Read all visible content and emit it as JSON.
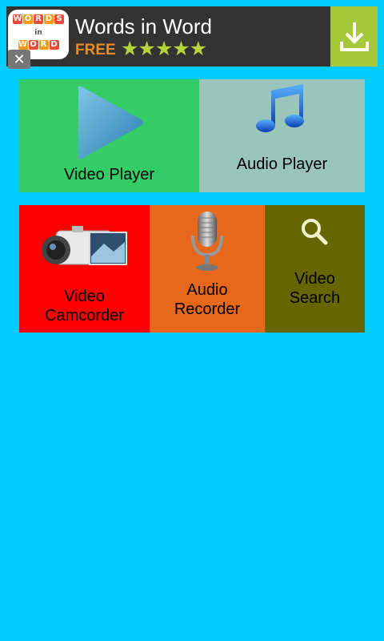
{
  "ad": {
    "title": "Words in Word",
    "price": "FREE",
    "stars": "★★★★★",
    "logo_rows": [
      [
        "W",
        "O",
        "R",
        "D",
        "S"
      ],
      [
        "in"
      ],
      [
        "W",
        "O",
        "R",
        "D"
      ]
    ],
    "close_symbol": "✕",
    "colors": {
      "background": "#333333",
      "download": "#A8C83B",
      "free": "#F08A24",
      "stars": "#B5D43B"
    }
  },
  "tiles": {
    "video_player": {
      "label": "Video Player",
      "color": "#33CC66"
    },
    "audio_player": {
      "label": "Audio Player",
      "color": "#99C5BB"
    },
    "video_camcorder": {
      "label_line1": "Video",
      "label_line2": "Camcorder",
      "color": "#FF0000"
    },
    "audio_recorder": {
      "label_line1": "Audio",
      "label_line2": "Recorder",
      "color": "#E8681B"
    },
    "video_search": {
      "label_line1": "Video",
      "label_line2": "Search",
      "color": "#666600"
    }
  },
  "icons": {
    "video_player": "play-icon",
    "audio_player": "music-note-icon",
    "video_camcorder": "camcorder-icon",
    "audio_recorder": "microphone-icon",
    "video_search": "search-icon",
    "ad_download": "download-icon",
    "ad_close": "close-icon"
  },
  "background_color": "#00CCFF"
}
